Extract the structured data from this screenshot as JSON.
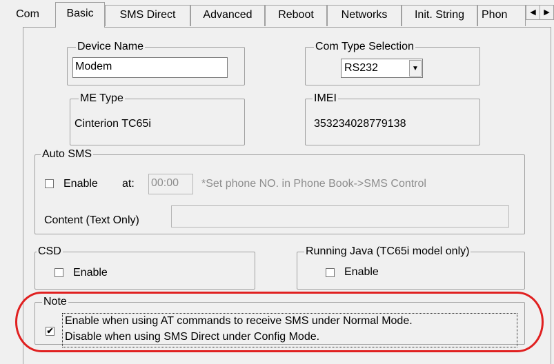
{
  "tabs": [
    {
      "label": "Com"
    },
    {
      "label": "Basic"
    },
    {
      "label": "SMS Direct"
    },
    {
      "label": "Advanced"
    },
    {
      "label": "Reboot"
    },
    {
      "label": "Networks"
    },
    {
      "label": "Init. String"
    },
    {
      "label": "Phon"
    }
  ],
  "tab_scroll": {
    "left": "◀",
    "right": "▶"
  },
  "device_name": {
    "legend": "Device Name",
    "value": "Modem"
  },
  "com_type": {
    "legend": "Com Type Selection",
    "selected": "RS232"
  },
  "me_type": {
    "legend": "ME Type",
    "value": "Cinterion TC65i"
  },
  "imei": {
    "legend": "IMEI",
    "value": "353234028779138"
  },
  "auto_sms": {
    "legend": "Auto SMS",
    "enable_label": "Enable",
    "at_label": "at:",
    "time_value": "00:00",
    "hint": "*Set phone NO. in Phone Book->SMS Control",
    "content_label": "Content (Text Only)",
    "content_value": ""
  },
  "csd": {
    "legend": "CSD",
    "enable_label": "Enable"
  },
  "running_java": {
    "legend": "Running Java (TC65i model only)",
    "enable_label": "Enable"
  },
  "note": {
    "legend": "Note",
    "line1": "Enable when using AT commands to receive SMS under Normal Mode.",
    "line2": "Disable when using SMS Direct under Config Mode.",
    "checked_mark": "✔"
  },
  "colors": {
    "highlight_oval": "#e02020",
    "window_bg": "#f0f0f0"
  }
}
